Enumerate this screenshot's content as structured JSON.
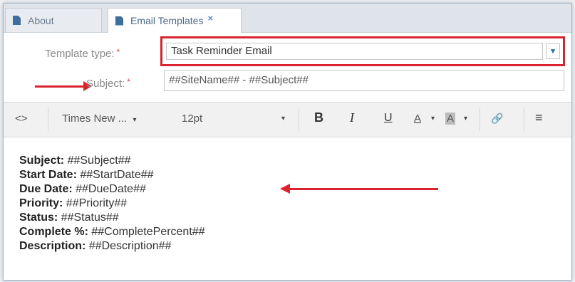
{
  "tabs": {
    "about": {
      "label": "About"
    },
    "email": {
      "label": "Email Templates",
      "close": "×"
    }
  },
  "form": {
    "template_type": {
      "label": "Template type:",
      "required": "*",
      "value": "Task Reminder Email",
      "arrow": "▾"
    },
    "subject": {
      "label": "Subject:",
      "required": "*",
      "value": "##SiteName## - ##Subject##"
    }
  },
  "toolbar": {
    "code": "<>",
    "font_family": "Times New ...",
    "font_size": "12pt",
    "bold": "B",
    "italic": "I",
    "underline": "U",
    "font_color": "A",
    "bg_color": "A",
    "link": "🔗",
    "align": "≡",
    "caret": "▾"
  },
  "body_lines": [
    {
      "label": "Subject:",
      "value": " ##Subject##"
    },
    {
      "label": "Start Date:",
      "value": " ##StartDate##"
    },
    {
      "label": "Due Date:",
      "value": " ##DueDate##"
    },
    {
      "label": "Priority:",
      "value": " ##Priority##"
    },
    {
      "label": "Status:",
      "value": " ##Status##"
    },
    {
      "label": "Complete %:",
      "value": " ##CompletePercent##"
    },
    {
      "label": "Description:",
      "value": " ##Description##"
    }
  ],
  "colors": {
    "highlight": "#d9232e",
    "accent": "#2a6db4"
  }
}
